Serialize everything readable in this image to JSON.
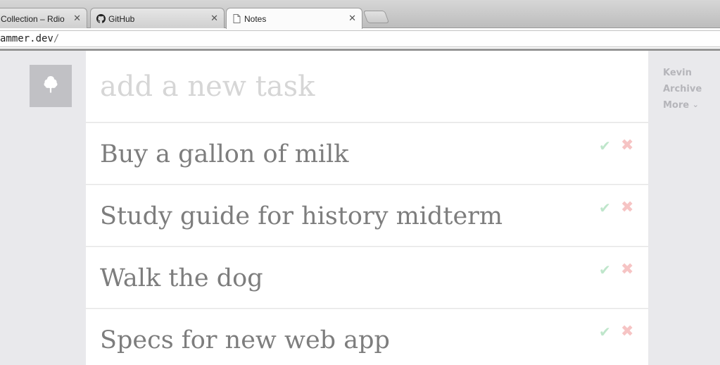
{
  "browser": {
    "tabs": [
      {
        "title": "Collection – Rdio",
        "icon": "none"
      },
      {
        "title": "GitHub",
        "icon": "github-icon"
      },
      {
        "title": "Notes",
        "icon": "document-icon"
      }
    ],
    "close_glyph": "✕",
    "url": {
      "host": "ammer.dev",
      "path": "/"
    }
  },
  "app": {
    "logo_icon": "tree-icon",
    "new_task_placeholder": "add a new task",
    "tasks": [
      {
        "text": "Buy a gallon of milk"
      },
      {
        "text": "Study guide for history midterm"
      },
      {
        "text": "Walk the dog"
      },
      {
        "text": "Specs for new web app"
      }
    ],
    "complete_glyph": "✔",
    "delete_glyph": "✖",
    "sidebar": {
      "user": "Kevin",
      "archive": "Archive",
      "more": "More",
      "more_chevron": "⌄"
    },
    "colors": {
      "complete": "#bfe6cb",
      "delete": "#f6c4c4",
      "task_text": "#7d7d7d",
      "sidebar_link": "#b5b5ba"
    }
  }
}
